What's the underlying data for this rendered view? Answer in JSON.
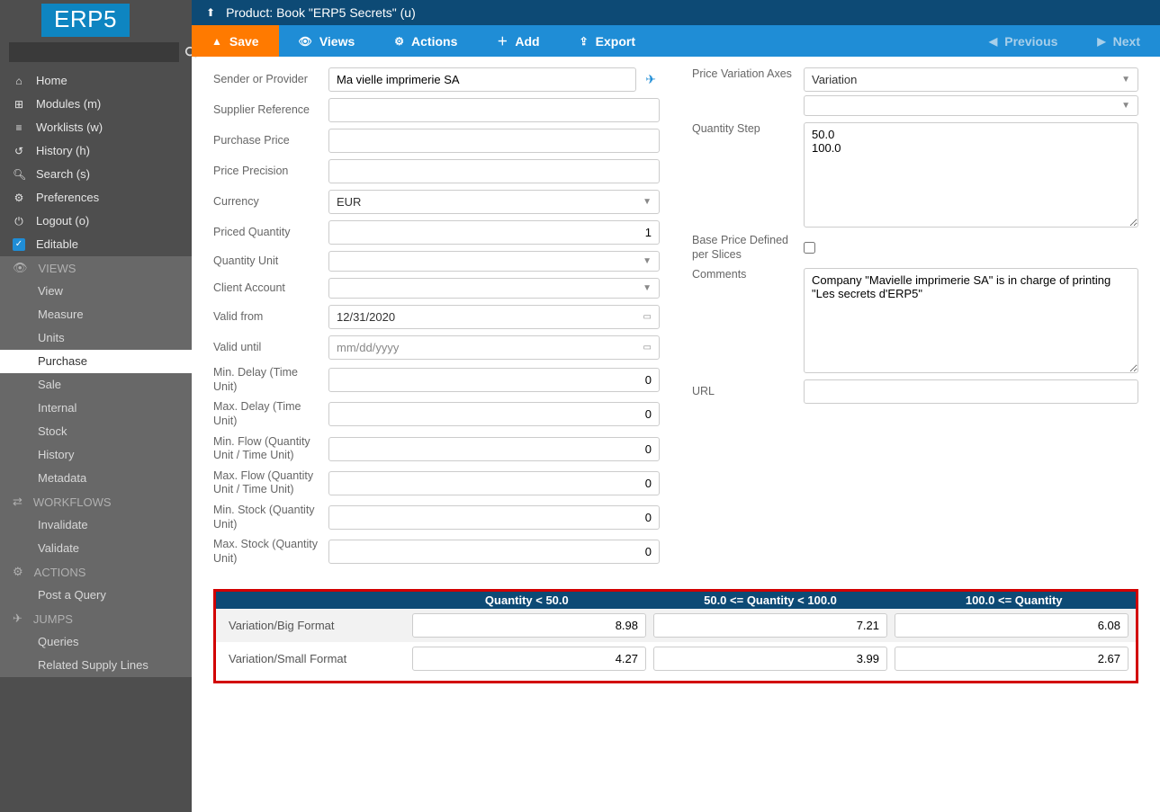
{
  "logo": "ERP5",
  "search": {
    "placeholder": ""
  },
  "nav": {
    "home": "Home",
    "modules": "Modules (m)",
    "worklists": "Worklists (w)",
    "history": "History (h)",
    "search": "Search (s)",
    "preferences": "Preferences",
    "logout": "Logout (o)",
    "editable": "Editable"
  },
  "sections": {
    "views": {
      "head": "VIEWS",
      "items": [
        "View",
        "Measure",
        "Units",
        "Purchase",
        "Sale",
        "Internal",
        "Stock",
        "History",
        "Metadata"
      ],
      "active": "Purchase"
    },
    "workflows": {
      "head": "WORKFLOWS",
      "items": [
        "Invalidate",
        "Validate"
      ]
    },
    "actions": {
      "head": "ACTIONS",
      "items": [
        "Post a Query"
      ]
    },
    "jumps": {
      "head": "JUMPS",
      "items": [
        "Queries",
        "Related Supply Lines"
      ]
    }
  },
  "title": "Product: Book \"ERP5 Secrets\" (u)",
  "toolbar": {
    "save": "Save",
    "views": "Views",
    "actions": "Actions",
    "add": "Add",
    "export": "Export",
    "prev": "Previous",
    "next": "Next"
  },
  "left": {
    "sender_label": "Sender or Provider",
    "sender_value": "Ma vielle imprimerie SA",
    "supplier_ref_label": "Supplier Reference",
    "supplier_ref_value": "",
    "purchase_price_label": "Purchase Price",
    "purchase_price_value": "",
    "price_precision_label": "Price Precision",
    "price_precision_value": "",
    "currency_label": "Currency",
    "currency_value": "EUR",
    "priced_qty_label": "Priced Quantity",
    "priced_qty_value": "1",
    "qty_unit_label": "Quantity Unit",
    "qty_unit_value": "",
    "client_account_label": "Client Account",
    "client_account_value": "",
    "valid_from_label": "Valid from",
    "valid_from_value": "12/31/2020",
    "valid_until_label": "Valid until",
    "valid_until_placeholder": "mm/dd/yyyy",
    "valid_until_value": "",
    "min_delay_label": "Min. Delay (Time Unit)",
    "min_delay_value": "0",
    "max_delay_label": "Max. Delay (Time Unit)",
    "max_delay_value": "0",
    "min_flow_label": "Min. Flow (Quantity Unit / Time Unit)",
    "min_flow_value": "0",
    "max_flow_label": "Max. Flow (Quantity Unit / Time Unit)",
    "max_flow_value": "0",
    "min_stock_label": "Min. Stock (Quantity Unit)",
    "min_stock_value": "0",
    "max_stock_label": "Max. Stock (Quantity Unit)",
    "max_stock_value": "0"
  },
  "right": {
    "axes_label": "Price Variation Axes",
    "axes_value": "Variation",
    "axes_value2": "",
    "qstep_label": "Quantity Step",
    "qstep_value": "50.0\n100.0",
    "slice_label": "Base Price Defined per Slices",
    "comments_label": "Comments",
    "comments_value": "Company \"Mavielle imprimerie SA\" is in charge of printing \"Les secrets d'ERP5\"",
    "url_label": "URL",
    "url_value": ""
  },
  "matrix": {
    "cols": [
      "Quantity < 50.0",
      "50.0 <= Quantity < 100.0",
      "100.0 <= Quantity"
    ],
    "rows": [
      {
        "label": "Variation/Big Format",
        "vals": [
          "8.98",
          "7.21",
          "6.08"
        ]
      },
      {
        "label": "Variation/Small Format",
        "vals": [
          "4.27",
          "3.99",
          "2.67"
        ]
      }
    ]
  },
  "chart_data": {
    "type": "table",
    "title": "Purchase price matrix by variation and quantity range",
    "columns": [
      "Quantity < 50.0",
      "50.0 <= Quantity < 100.0",
      "100.0 <= Quantity"
    ],
    "rows": [
      "Variation/Big Format",
      "Variation/Small Format"
    ],
    "values": [
      [
        8.98,
        7.21,
        6.08
      ],
      [
        4.27,
        3.99,
        2.67
      ]
    ]
  }
}
